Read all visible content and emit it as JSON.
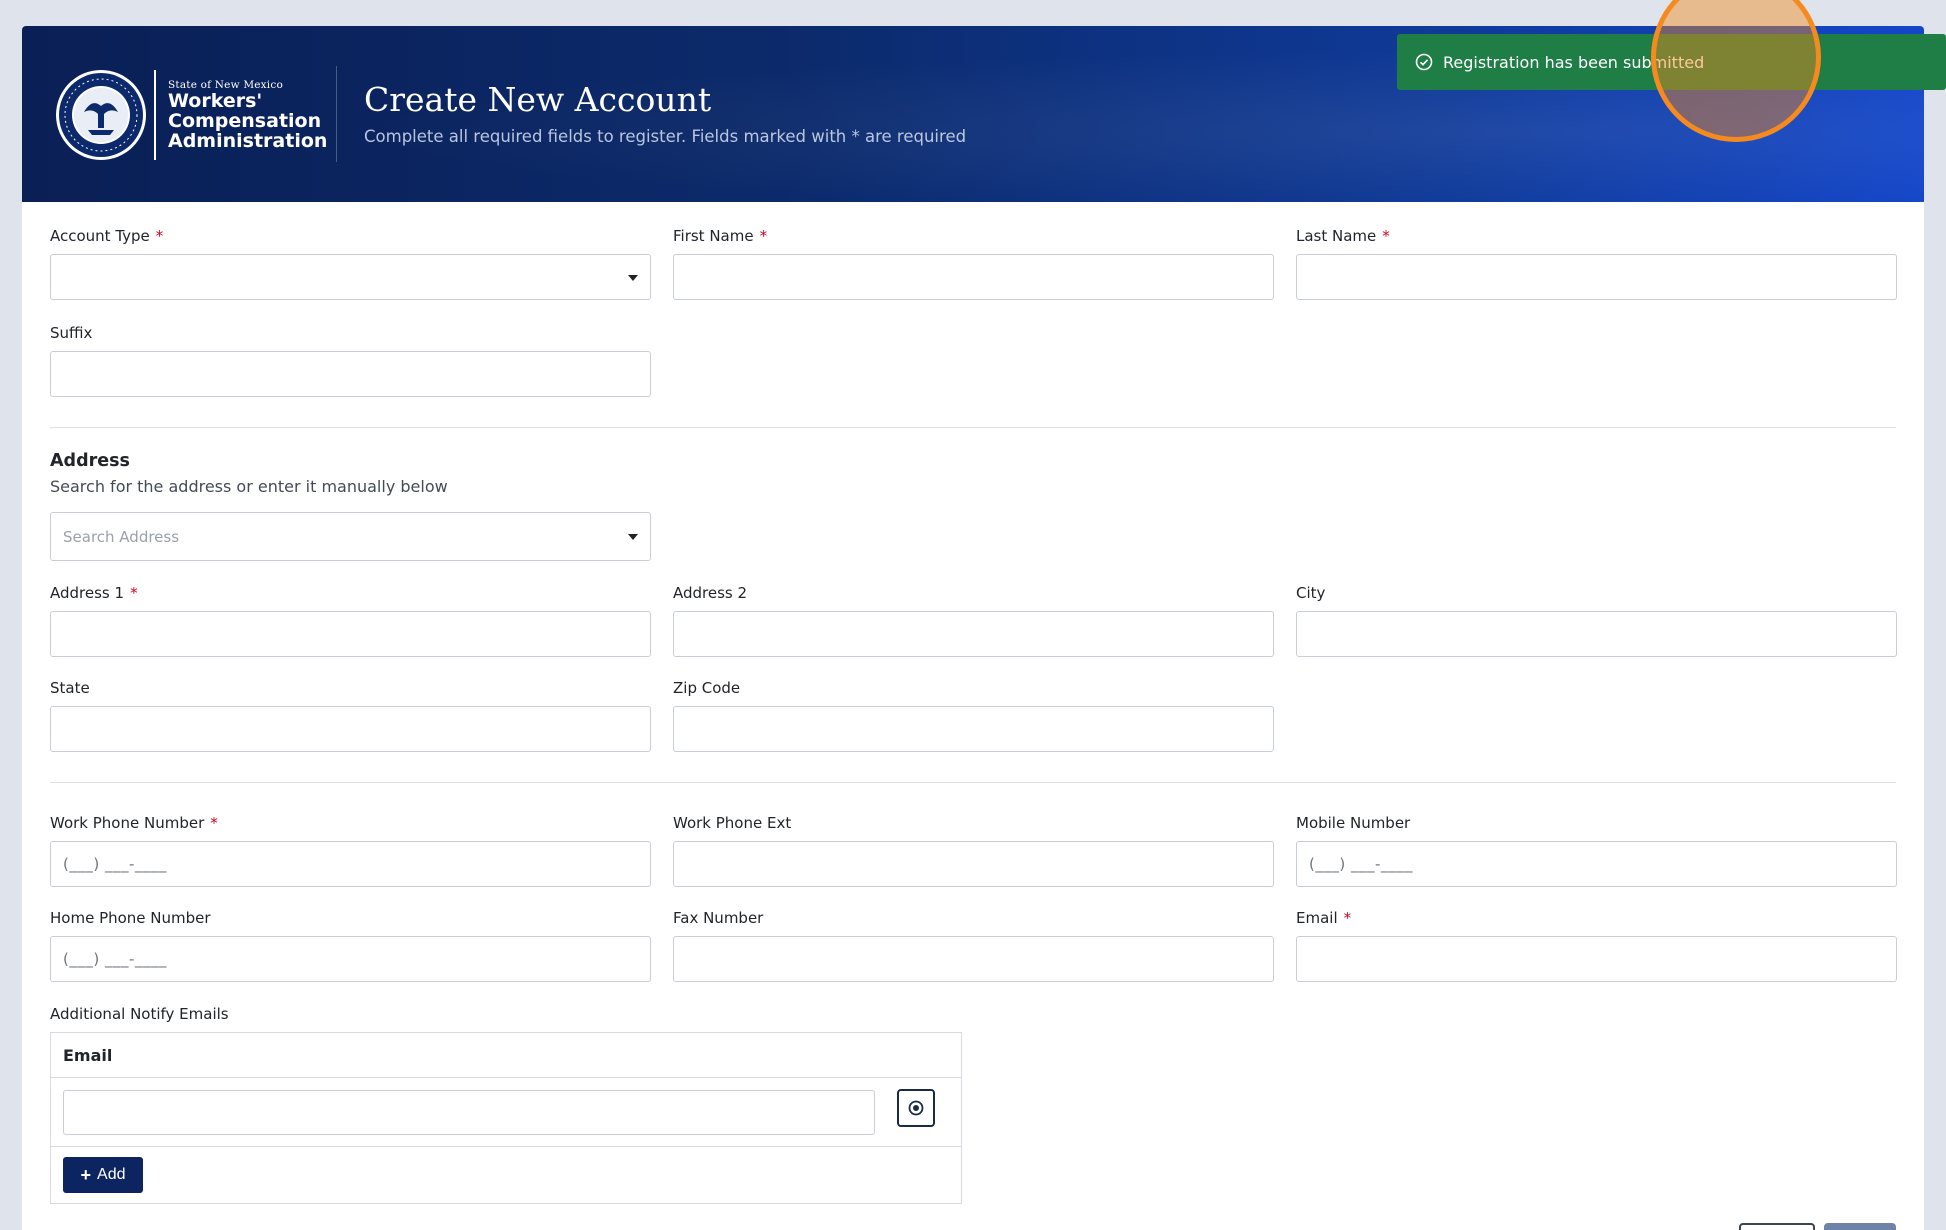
{
  "header": {
    "logo_small": "State of New Mexico",
    "logo_line1": "Workers'",
    "logo_line2": "Compensation",
    "logo_line3": "Administration",
    "seal_text": "GREAT SEAL OF THE STATE OF NEW MEXICO 1912",
    "title": "Create New Account",
    "subtitle": "Complete all required fields to register. Fields marked with * are required"
  },
  "toast": {
    "message": "Registration has been submitted"
  },
  "required_marker": "*",
  "fields": {
    "account_type": {
      "label": "Account Type",
      "value": ""
    },
    "first_name": {
      "label": "First Name",
      "value": ""
    },
    "last_name": {
      "label": "Last Name",
      "value": ""
    },
    "suffix": {
      "label": "Suffix",
      "value": ""
    },
    "address1": {
      "label": "Address 1",
      "value": ""
    },
    "address2": {
      "label": "Address 2",
      "value": ""
    },
    "city": {
      "label": "City",
      "value": ""
    },
    "state": {
      "label": "State",
      "value": ""
    },
    "zip": {
      "label": "Zip Code",
      "value": ""
    },
    "work_phone": {
      "label": "Work Phone Number",
      "mask": "(___) ___-____"
    },
    "work_phone_ext": {
      "label": "Work Phone Ext",
      "value": ""
    },
    "mobile": {
      "label": "Mobile Number",
      "mask": "(___) ___-____"
    },
    "home_phone": {
      "label": "Home Phone Number",
      "mask": "(___) ___-____"
    },
    "fax": {
      "label": "Fax Number",
      "value": ""
    },
    "email": {
      "label": "Email",
      "value": ""
    }
  },
  "address_section": {
    "title": "Address",
    "description": "Search for the address or enter it manually below",
    "search_placeholder": "Search Address"
  },
  "notify_emails": {
    "label": "Additional Notify Emails",
    "column_header": "Email",
    "add_label": "Add"
  },
  "colors": {
    "header_bg": "#0c2a6b",
    "toast_bg": "#1e7e46",
    "required": "#d0021b",
    "add_button": "#0c2460",
    "highlight": "#f58a1f"
  }
}
